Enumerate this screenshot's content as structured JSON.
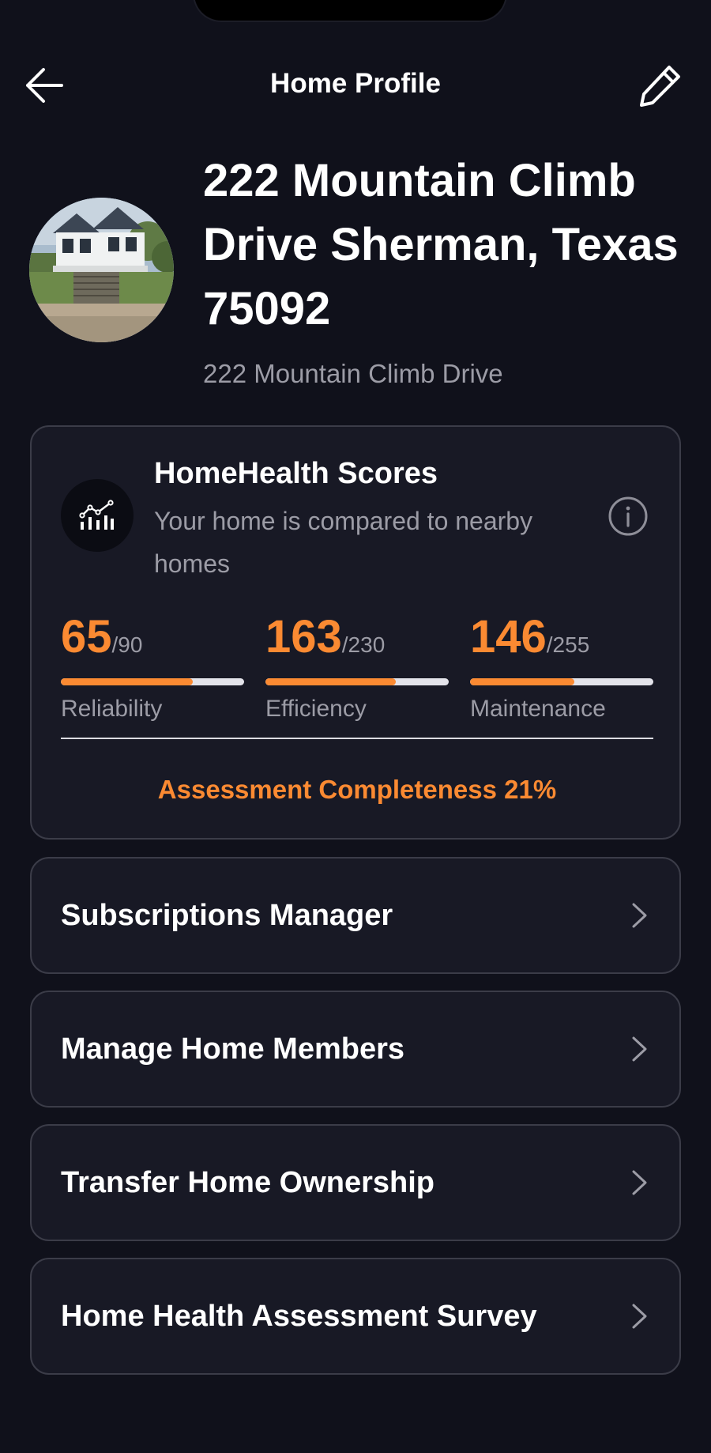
{
  "header": {
    "title": "Home Profile",
    "back_icon": "arrow-left-icon",
    "edit_icon": "pencil-icon"
  },
  "profile": {
    "address_title": "222 Mountain Climb Drive Sherman, Texas 75092",
    "address_subtitle": "222 Mountain Climb Drive",
    "avatar": "house-photo"
  },
  "scores_card": {
    "title": "HomeHealth Scores",
    "subtitle": "Your home is compared to nearby homes",
    "icon": "chart-line-icon",
    "info_icon": "info-icon",
    "metrics": [
      {
        "label": "Reliability",
        "value": "65",
        "max": "/90",
        "fill": 0.72
      },
      {
        "label": "Efficiency",
        "value": "163",
        "max": "/230",
        "fill": 0.71
      },
      {
        "label": "Maintenance",
        "value": "146",
        "max": "/255",
        "fill": 0.57
      }
    ],
    "completeness_text": "Assessment Completeness 21%"
  },
  "menu": {
    "items": [
      {
        "label": "Subscriptions Manager"
      },
      {
        "label": "Manage Home Members"
      },
      {
        "label": "Transfer Home Ownership"
      },
      {
        "label": "Home Health Assessment Survey"
      }
    ],
    "chevron_icon": "chevron-right-icon"
  },
  "colors": {
    "background": "#10111b",
    "card": "#181925",
    "accent": "#fb8a32",
    "muted_text": "#9c9ca6"
  }
}
